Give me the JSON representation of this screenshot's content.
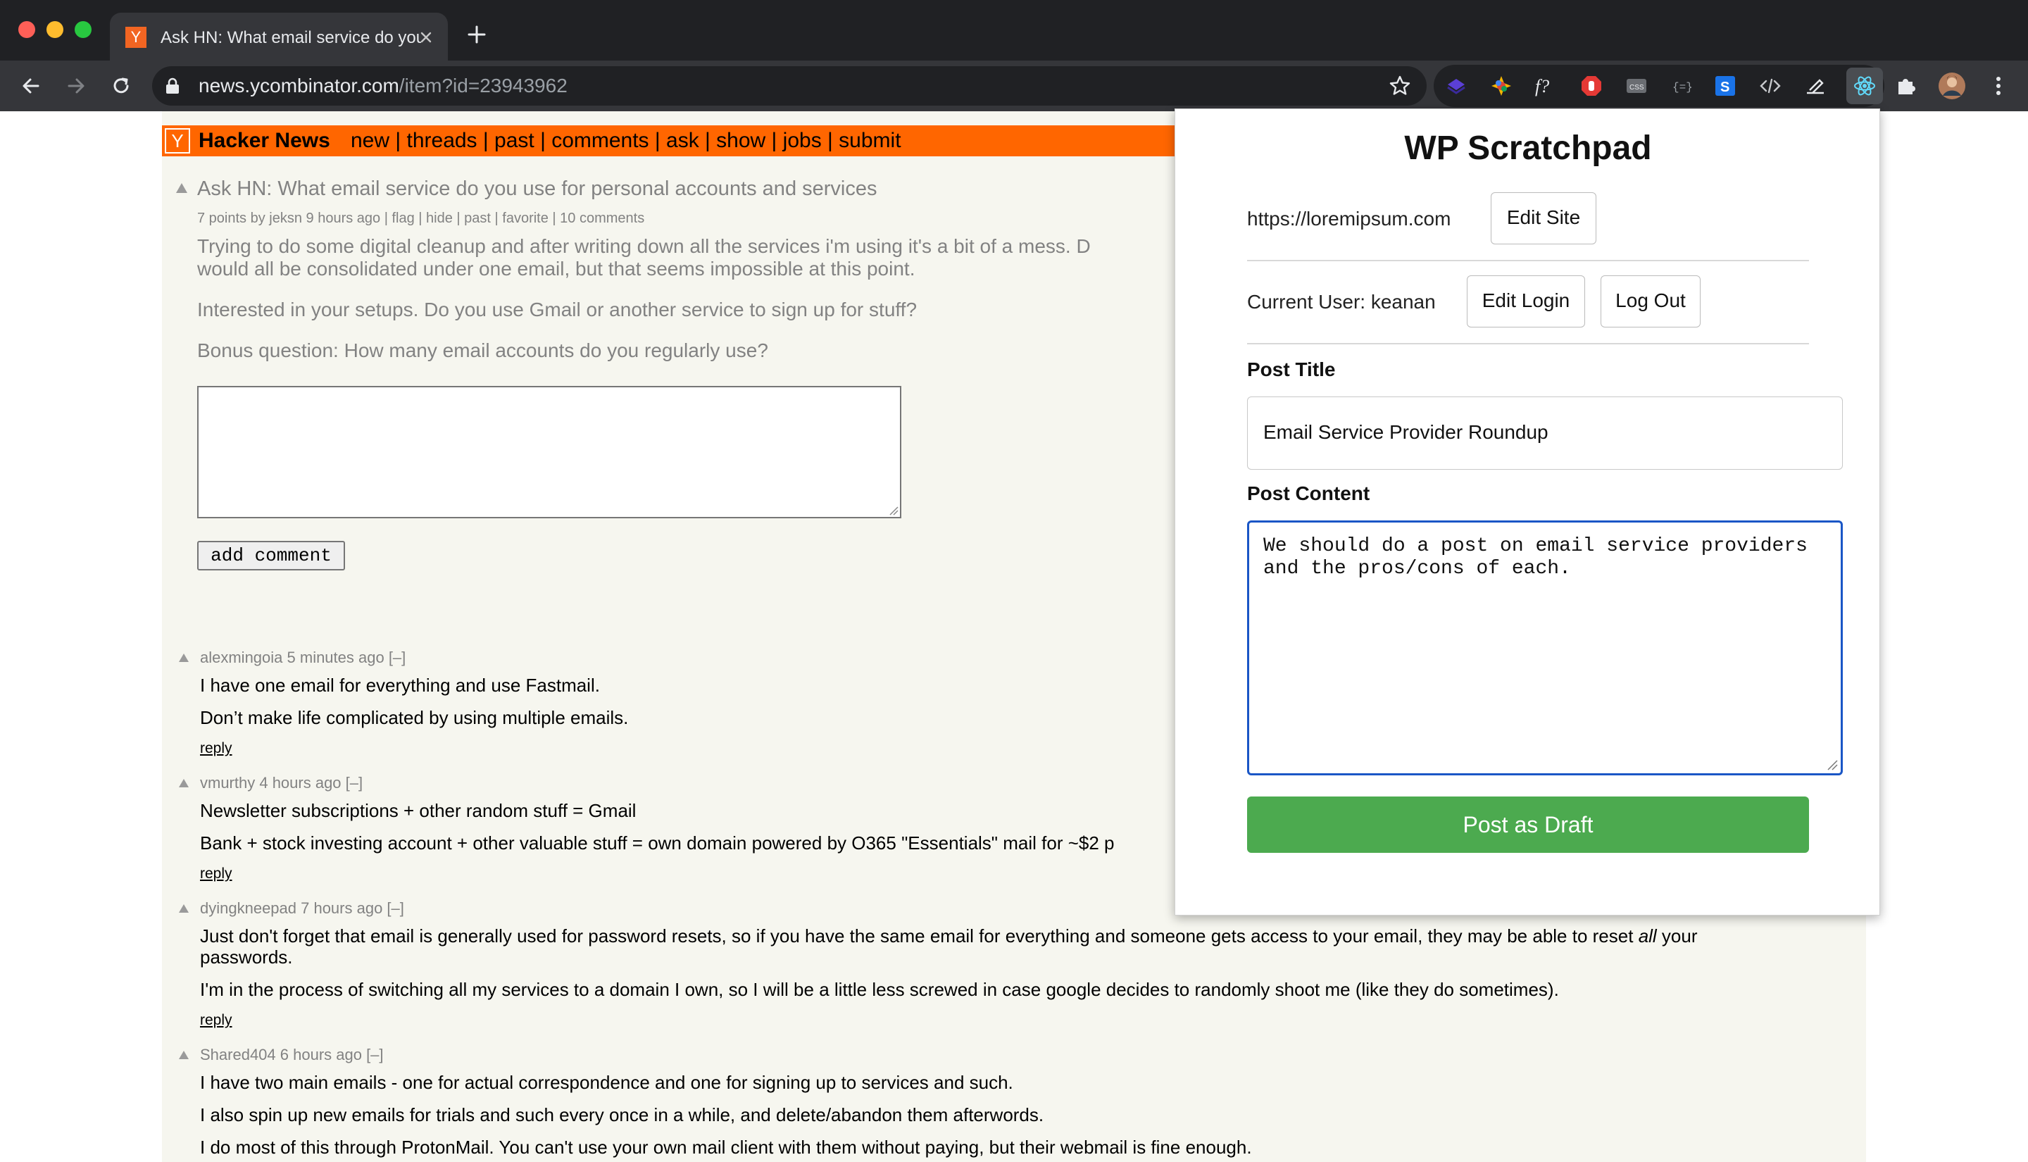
{
  "browser": {
    "tab_title": "Ask HN: What email service do you use for personal accounts and services",
    "favicon_letter": "Y",
    "url_host": "news.ycombinator.com",
    "url_path": "/item?id=23943962"
  },
  "hn": {
    "logo": "Y",
    "brand": "Hacker News",
    "nav": "new | threads | past | comments | ask | show | jobs | submit",
    "story": {
      "title": "Ask HN: What email service do you use for personal accounts and services",
      "subtext": "7 points by jeksn 9 hours ago | flag | hide | past | favorite | 10 comments",
      "paragraphs": [
        "Trying to do some digital cleanup and after writing down all the services i'm using it's a bit of a mess. D",
        "would all be consolidated under one email, but that seems impossible at this point.",
        "Interested in your setups. Do you use Gmail or another service to sign up for stuff?",
        "Bonus question: How many email accounts do you regularly use?"
      ]
    },
    "add_comment_label": "add comment",
    "comments": [
      {
        "head": "alexmingoia 5 minutes ago [–]",
        "lines": [
          "I have one email for everything and use Fastmail.",
          "Don’t make life complicated by using multiple emails."
        ],
        "reply": "reply"
      },
      {
        "head": "vmurthy 4 hours ago [–]",
        "lines": [
          "Newsletter subscriptions + other random stuff = Gmail",
          "Bank + stock investing account + other valuable stuff = own domain powered by O365 \"Essentials\" mail for ~$2 p"
        ],
        "reply": "reply"
      },
      {
        "head": "dyingkneepad 7 hours ago [–]",
        "line1_pre": "Just don't forget that email is generally used for password resets, so if you have the same email for everything and someone gets access to your email, they may be able to reset ",
        "line1_em": "all",
        "line1_post": " your",
        "line2": "passwords.",
        "line3": "I'm in the process of switching all my services to a domain I own, so I will be a little less screwed in case google decides to randomly shoot me (like they do sometimes).",
        "reply": "reply"
      },
      {
        "head": "Shared404 6 hours ago [–]",
        "lines": [
          "I have two main emails - one for actual correspondence and one for signing up to services and such.",
          "I also spin up new emails for trials and such every once in a while, and delete/abandon them afterwords.",
          "I do most of this through ProtonMail. You can't use your own mail client with them without paying, but their webmail is fine enough."
        ]
      }
    ]
  },
  "scratchpad": {
    "title": "WP Scratchpad",
    "site_url": "https://loremipsum.com",
    "edit_site": "Edit Site",
    "current_user": "Current User: keanan",
    "edit_login": "Edit Login",
    "log_out": "Log Out",
    "post_title_label": "Post Title",
    "post_title_value": "Email Service Provider Roundup",
    "post_content_label": "Post Content",
    "post_content_value": "We should do a post on email service providers\nand the pros/cons of each.",
    "post_button": "Post as Draft"
  }
}
